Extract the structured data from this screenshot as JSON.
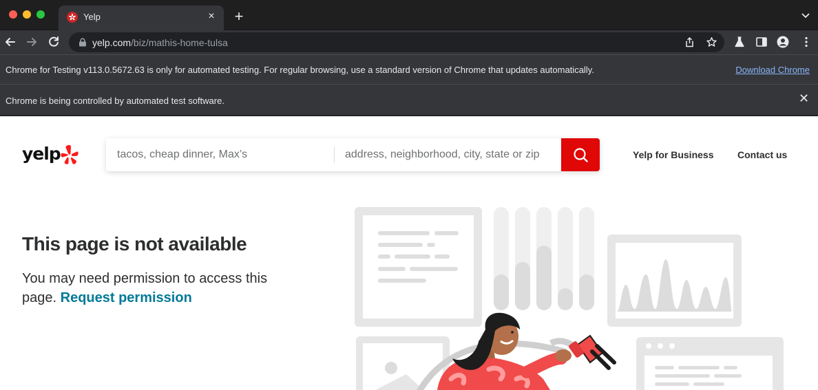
{
  "browser": {
    "tab_title": "Yelp",
    "url_host": "yelp.com",
    "url_path": "/biz/mathis-home-tulsa",
    "infobar_testing_message": "Chrome for Testing v113.0.5672.63 is only for automated testing. For regular browsing, use a standard version of Chrome that updates automatically.",
    "infobar_download_link": "Download Chrome",
    "infobar_automation_message": "Chrome is being controlled by automated test software."
  },
  "header": {
    "logo_text": "yelp",
    "search_find_placeholder": "tacos, cheap dinner, Max’s",
    "search_near_placeholder": "address, neighborhood, city, state or zip",
    "nav_business": "Yelp for Business",
    "nav_contact": "Contact us"
  },
  "main": {
    "title": "This page is not available",
    "message": "You may need permission to access this page.",
    "link": "Request permission"
  },
  "colors": {
    "brand_red": "#e00707",
    "link_teal": "#027a97",
    "text_dark": "#2d2e2f"
  }
}
